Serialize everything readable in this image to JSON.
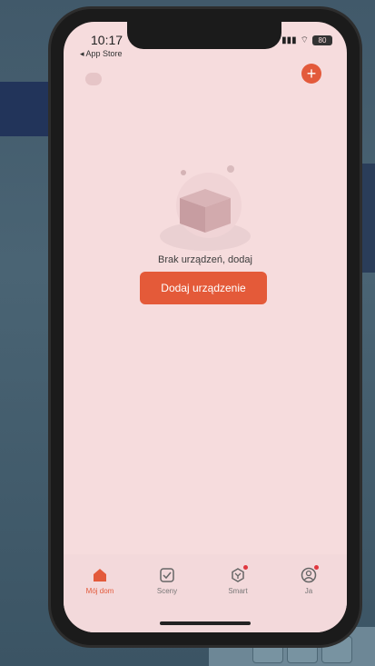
{
  "status_bar": {
    "time": "10:17",
    "back_app": "◂ App Store",
    "battery": "80"
  },
  "empty_state": {
    "message": "Brak urządzeń, dodaj",
    "add_device_button": "Dodaj urządzenie"
  },
  "tabbar": {
    "items": [
      {
        "label": "Mój dom",
        "icon": "home-icon",
        "active": true
      },
      {
        "label": "Sceny",
        "icon": "scenes-icon",
        "active": false
      },
      {
        "label": "Smart",
        "icon": "smart-icon",
        "active": false
      },
      {
        "label": "Ja",
        "icon": "profile-icon",
        "active": false
      }
    ]
  },
  "colors": {
    "accent": "#E45A39",
    "screen_bg": "#F6DCDD"
  }
}
